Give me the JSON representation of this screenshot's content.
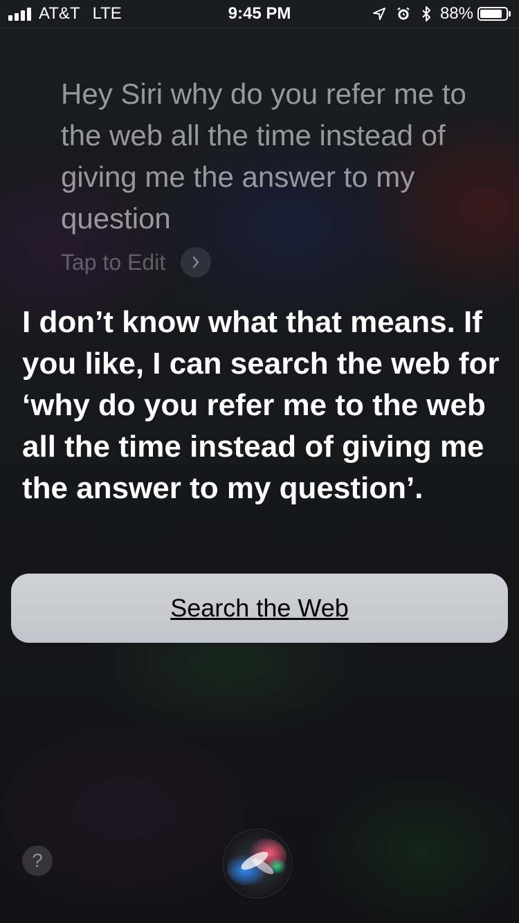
{
  "status_bar": {
    "carrier": "AT&T",
    "network": "LTE",
    "time": "9:45 PM",
    "battery_percent": "88%",
    "battery_level": 0.88,
    "icons": [
      "signal-bars-icon",
      "location-arrow-icon",
      "alarm-clock-icon",
      "bluetooth-icon",
      "battery-icon"
    ]
  },
  "query": {
    "text": "Hey Siri why do you refer me to the web all the time instead of giving me the answer to my question",
    "tap_to_edit_label": "Tap to Edit"
  },
  "answer": {
    "text": "I don’t know what that means. If you like, I can search the web for ‘why do you refer me to the web all the time instead of giving me the answer to my question’."
  },
  "actions": {
    "search_web_label": "Search the Web"
  },
  "bottom": {
    "help_label": "?"
  },
  "colors": {
    "background": "#17181b",
    "button_background": "#c9c9d1",
    "query_text": "#8c8c8f",
    "answer_text": "#ffffff"
  }
}
